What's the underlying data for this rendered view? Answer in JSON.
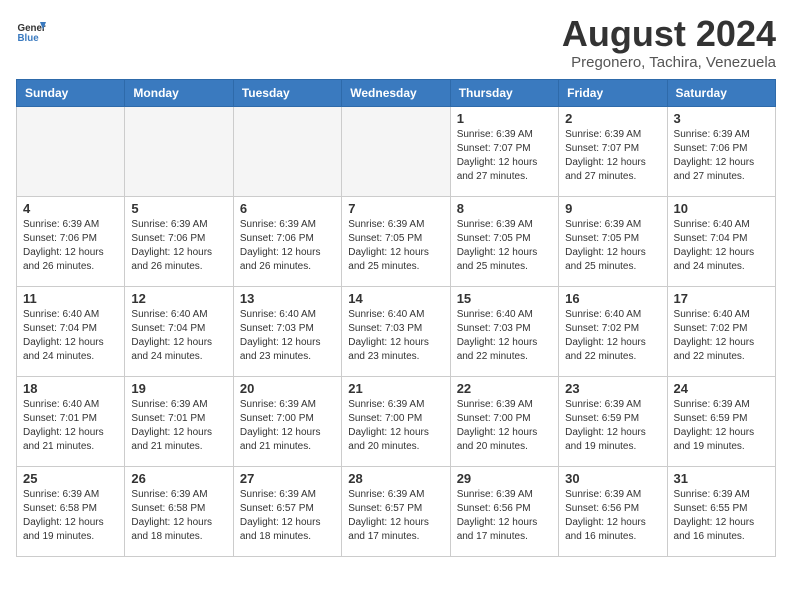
{
  "logo": {
    "line1": "General",
    "line2": "Blue"
  },
  "title": "August 2024",
  "subtitle": "Pregonero, Tachira, Venezuela",
  "days_of_week": [
    "Sunday",
    "Monday",
    "Tuesday",
    "Wednesday",
    "Thursday",
    "Friday",
    "Saturday"
  ],
  "weeks": [
    [
      {
        "day": "",
        "empty": true
      },
      {
        "day": "",
        "empty": true
      },
      {
        "day": "",
        "empty": true
      },
      {
        "day": "",
        "empty": true
      },
      {
        "day": "1",
        "sunrise": "Sunrise: 6:39 AM",
        "sunset": "Sunset: 7:07 PM",
        "daylight": "Daylight: 12 hours and 27 minutes."
      },
      {
        "day": "2",
        "sunrise": "Sunrise: 6:39 AM",
        "sunset": "Sunset: 7:07 PM",
        "daylight": "Daylight: 12 hours and 27 minutes."
      },
      {
        "day": "3",
        "sunrise": "Sunrise: 6:39 AM",
        "sunset": "Sunset: 7:06 PM",
        "daylight": "Daylight: 12 hours and 27 minutes."
      }
    ],
    [
      {
        "day": "4",
        "sunrise": "Sunrise: 6:39 AM",
        "sunset": "Sunset: 7:06 PM",
        "daylight": "Daylight: 12 hours and 26 minutes."
      },
      {
        "day": "5",
        "sunrise": "Sunrise: 6:39 AM",
        "sunset": "Sunset: 7:06 PM",
        "daylight": "Daylight: 12 hours and 26 minutes."
      },
      {
        "day": "6",
        "sunrise": "Sunrise: 6:39 AM",
        "sunset": "Sunset: 7:06 PM",
        "daylight": "Daylight: 12 hours and 26 minutes."
      },
      {
        "day": "7",
        "sunrise": "Sunrise: 6:39 AM",
        "sunset": "Sunset: 7:05 PM",
        "daylight": "Daylight: 12 hours and 25 minutes."
      },
      {
        "day": "8",
        "sunrise": "Sunrise: 6:39 AM",
        "sunset": "Sunset: 7:05 PM",
        "daylight": "Daylight: 12 hours and 25 minutes."
      },
      {
        "day": "9",
        "sunrise": "Sunrise: 6:39 AM",
        "sunset": "Sunset: 7:05 PM",
        "daylight": "Daylight: 12 hours and 25 minutes."
      },
      {
        "day": "10",
        "sunrise": "Sunrise: 6:40 AM",
        "sunset": "Sunset: 7:04 PM",
        "daylight": "Daylight: 12 hours and 24 minutes."
      }
    ],
    [
      {
        "day": "11",
        "sunrise": "Sunrise: 6:40 AM",
        "sunset": "Sunset: 7:04 PM",
        "daylight": "Daylight: 12 hours and 24 minutes."
      },
      {
        "day": "12",
        "sunrise": "Sunrise: 6:40 AM",
        "sunset": "Sunset: 7:04 PM",
        "daylight": "Daylight: 12 hours and 24 minutes."
      },
      {
        "day": "13",
        "sunrise": "Sunrise: 6:40 AM",
        "sunset": "Sunset: 7:03 PM",
        "daylight": "Daylight: 12 hours and 23 minutes."
      },
      {
        "day": "14",
        "sunrise": "Sunrise: 6:40 AM",
        "sunset": "Sunset: 7:03 PM",
        "daylight": "Daylight: 12 hours and 23 minutes."
      },
      {
        "day": "15",
        "sunrise": "Sunrise: 6:40 AM",
        "sunset": "Sunset: 7:03 PM",
        "daylight": "Daylight: 12 hours and 22 minutes."
      },
      {
        "day": "16",
        "sunrise": "Sunrise: 6:40 AM",
        "sunset": "Sunset: 7:02 PM",
        "daylight": "Daylight: 12 hours and 22 minutes."
      },
      {
        "day": "17",
        "sunrise": "Sunrise: 6:40 AM",
        "sunset": "Sunset: 7:02 PM",
        "daylight": "Daylight: 12 hours and 22 minutes."
      }
    ],
    [
      {
        "day": "18",
        "sunrise": "Sunrise: 6:40 AM",
        "sunset": "Sunset: 7:01 PM",
        "daylight": "Daylight: 12 hours and 21 minutes."
      },
      {
        "day": "19",
        "sunrise": "Sunrise: 6:39 AM",
        "sunset": "Sunset: 7:01 PM",
        "daylight": "Daylight: 12 hours and 21 minutes."
      },
      {
        "day": "20",
        "sunrise": "Sunrise: 6:39 AM",
        "sunset": "Sunset: 7:00 PM",
        "daylight": "Daylight: 12 hours and 21 minutes."
      },
      {
        "day": "21",
        "sunrise": "Sunrise: 6:39 AM",
        "sunset": "Sunset: 7:00 PM",
        "daylight": "Daylight: 12 hours and 20 minutes."
      },
      {
        "day": "22",
        "sunrise": "Sunrise: 6:39 AM",
        "sunset": "Sunset: 7:00 PM",
        "daylight": "Daylight: 12 hours and 20 minutes."
      },
      {
        "day": "23",
        "sunrise": "Sunrise: 6:39 AM",
        "sunset": "Sunset: 6:59 PM",
        "daylight": "Daylight: 12 hours and 19 minutes."
      },
      {
        "day": "24",
        "sunrise": "Sunrise: 6:39 AM",
        "sunset": "Sunset: 6:59 PM",
        "daylight": "Daylight: 12 hours and 19 minutes."
      }
    ],
    [
      {
        "day": "25",
        "sunrise": "Sunrise: 6:39 AM",
        "sunset": "Sunset: 6:58 PM",
        "daylight": "Daylight: 12 hours and 19 minutes."
      },
      {
        "day": "26",
        "sunrise": "Sunrise: 6:39 AM",
        "sunset": "Sunset: 6:58 PM",
        "daylight": "Daylight: 12 hours and 18 minutes."
      },
      {
        "day": "27",
        "sunrise": "Sunrise: 6:39 AM",
        "sunset": "Sunset: 6:57 PM",
        "daylight": "Daylight: 12 hours and 18 minutes."
      },
      {
        "day": "28",
        "sunrise": "Sunrise: 6:39 AM",
        "sunset": "Sunset: 6:57 PM",
        "daylight": "Daylight: 12 hours and 17 minutes."
      },
      {
        "day": "29",
        "sunrise": "Sunrise: 6:39 AM",
        "sunset": "Sunset: 6:56 PM",
        "daylight": "Daylight: 12 hours and 17 minutes."
      },
      {
        "day": "30",
        "sunrise": "Sunrise: 6:39 AM",
        "sunset": "Sunset: 6:56 PM",
        "daylight": "Daylight: 12 hours and 16 minutes."
      },
      {
        "day": "31",
        "sunrise": "Sunrise: 6:39 AM",
        "sunset": "Sunset: 6:55 PM",
        "daylight": "Daylight: 12 hours and 16 minutes."
      }
    ]
  ]
}
